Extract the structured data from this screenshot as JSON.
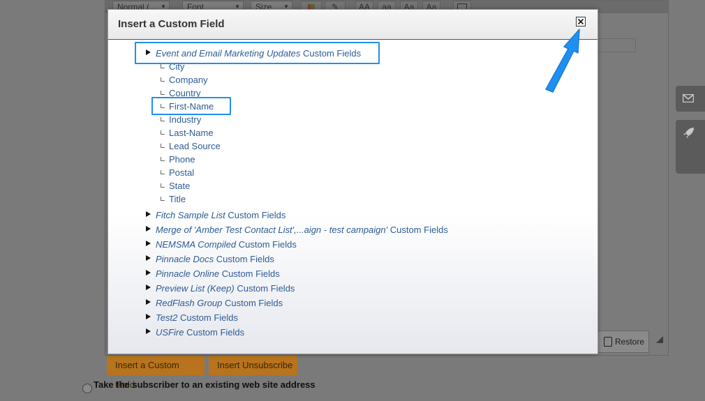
{
  "toolbar": {
    "format_select": "Normal (...",
    "font_select": "Font",
    "size_select": "Size",
    "text_buttons": [
      "AA",
      "aa",
      "Aa",
      "Aa"
    ]
  },
  "background": {
    "restore_label": "Restore",
    "insert_custom_field_label": "Insert a Custom Field",
    "insert_unsubscribe_label": "Insert Unsubscribe",
    "radio_label": "Take the subscriber to an existing web site address"
  },
  "modal": {
    "title": "Insert a Custom Field",
    "groups": [
      {
        "name": "Event and Email Marketing Updates",
        "suffix": "Custom Fields",
        "expanded": true,
        "children": [
          "City",
          "Company",
          "Country",
          "First-Name",
          "Industry",
          "Last-Name",
          "Lead Source",
          "Phone",
          "Postal",
          "State",
          "Title"
        ]
      },
      {
        "name": "Fitch Sample List",
        "suffix": "Custom Fields"
      },
      {
        "name": "Merge of 'Amber Test Contact List',...aign - test campaign'",
        "suffix": "Custom Fields"
      },
      {
        "name": "NEMSMA Compiled",
        "suffix": "Custom Fields"
      },
      {
        "name": "Pinnacle Docs",
        "suffix": "Custom Fields"
      },
      {
        "name": "Pinnacle Online",
        "suffix": "Custom Fields"
      },
      {
        "name": "Preview List (Keep)",
        "suffix": "Custom Fields"
      },
      {
        "name": "RedFlash Group",
        "suffix": "Custom Fields"
      },
      {
        "name": "Test2",
        "suffix": "Custom Fields"
      },
      {
        "name": "USFire",
        "suffix": "Custom Fields"
      }
    ]
  },
  "colors": {
    "link": "#2e5b93",
    "highlight": "#1f8ff0",
    "orange_button": "#b7731d"
  },
  "icons": [
    "close-icon",
    "mail-icon",
    "rocket-icon",
    "restore-icon",
    "expand-triangle-icon",
    "arrow-pointer-icon"
  ]
}
